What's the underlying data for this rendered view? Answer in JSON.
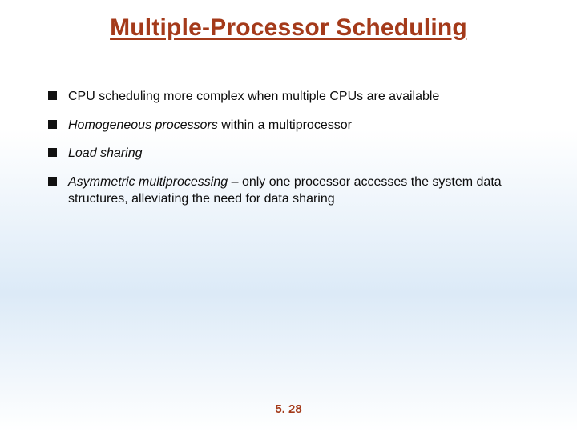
{
  "title": "Multiple-Processor Scheduling",
  "bullets": [
    {
      "pre": "",
      "em": "",
      "post": "CPU scheduling more complex when multiple CPUs are available"
    },
    {
      "pre": "",
      "em": "Homogeneous processors",
      "post": " within a multiprocessor"
    },
    {
      "pre": "",
      "em": "Load sharing",
      "post": ""
    },
    {
      "pre": "",
      "em": "Asymmetric multiprocessing",
      "post": " – only one processor accesses the system data structures, alleviating the need for data sharing"
    }
  ],
  "page_number": "5. 28"
}
